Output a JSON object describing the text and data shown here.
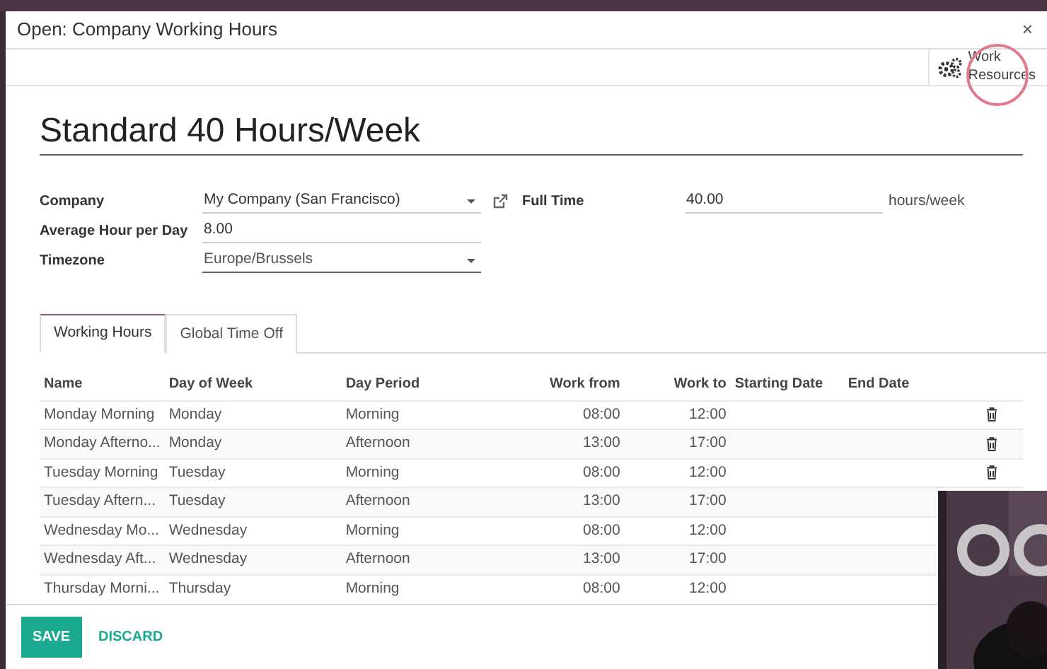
{
  "dialog": {
    "title": "Open: Company Working Hours",
    "close": "×"
  },
  "button_box": [
    {
      "label": "Work Resources"
    }
  ],
  "record": {
    "name": "Standard 40 Hours/Week"
  },
  "fields_left": [
    {
      "label": "Company",
      "value": "My Company (San Francisco)",
      "kind": "many2one"
    },
    {
      "label": "Average Hour per Day",
      "value": "8.00",
      "kind": "text"
    },
    {
      "label": "Timezone",
      "value": "Europe/Brussels",
      "kind": "select"
    }
  ],
  "fields_right": [
    {
      "label": "Full Time",
      "value": "40.00",
      "unit": "hours/week"
    }
  ],
  "tabs": [
    {
      "label": "Working Hours",
      "selected": true
    },
    {
      "label": "Global Time Off",
      "selected": false
    }
  ],
  "table": {
    "columns": [
      "Name",
      "Day of Week",
      "Day Period",
      "Work from",
      "Work to",
      "Starting Date",
      "End Date"
    ],
    "rows": [
      [
        "Monday Morning",
        "Monday",
        "Morning",
        "08:00",
        "12:00"
      ],
      [
        "Monday Afterno...",
        "Monday",
        "Afternoon",
        "13:00",
        "17:00"
      ],
      [
        "Tuesday Morning",
        "Tuesday",
        "Morning",
        "08:00",
        "12:00"
      ],
      [
        "Tuesday Aftern...",
        "Tuesday",
        "Afternoon",
        "13:00",
        "17:00"
      ],
      [
        "Wednesday Mo...",
        "Wednesday",
        "Morning",
        "08:00",
        "12:00"
      ],
      [
        "Wednesday Aft...",
        "Wednesday",
        "Afternoon",
        "13:00",
        "17:00"
      ],
      [
        "Thursday Morni...",
        "Thursday",
        "Morning",
        "08:00",
        "12:00"
      ]
    ]
  },
  "footer": [
    {
      "label": "SAVE",
      "kind": "primary"
    },
    {
      "label": "DISCARD",
      "kind": "link"
    }
  ]
}
